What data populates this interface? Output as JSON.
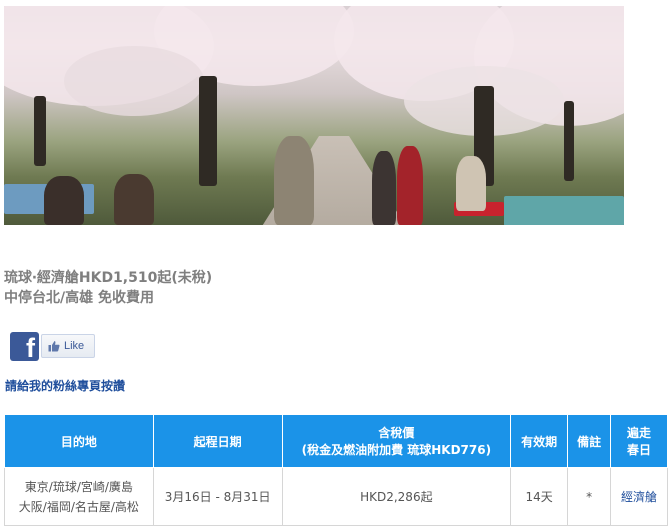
{
  "promo": {
    "line1": "琉球‧經濟艙HKD1,510起(未稅)",
    "line2": "中停台北/高雄 免收費用"
  },
  "facebook": {
    "logo_letter": "f",
    "like_label": "Like"
  },
  "fan_page_link": "請給我的粉絲專頁按讚",
  "table": {
    "headers": {
      "destination": "目的地",
      "departure_date": "起程日期",
      "tax_price_line1": "含稅價",
      "tax_price_line2": "(稅金及燃油附加費 琉球HKD776)",
      "validity": "有效期",
      "remarks": "備註",
      "spring_line1": "遍走",
      "spring_line2": "春日"
    },
    "rows": [
      {
        "destination_line1": "東京/琉球/宮崎/廣島",
        "destination_line2": "大阪/福岡/名古屋/高松",
        "departure_date": "3月16日 - 8月31日",
        "tax_price": "HKD2,286起",
        "validity": "14天",
        "remarks": "*",
        "spring": "經濟艙"
      }
    ]
  }
}
